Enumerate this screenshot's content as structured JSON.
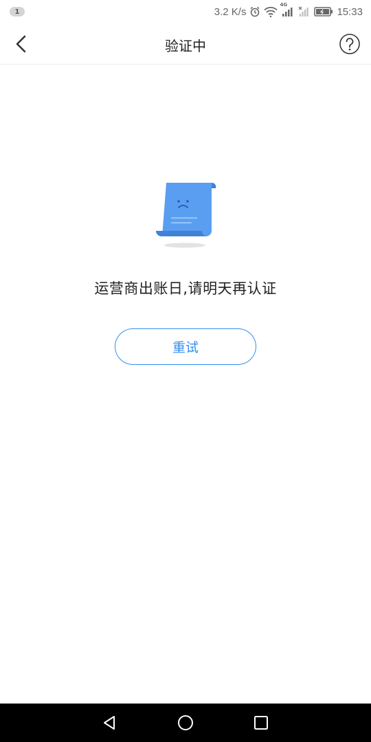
{
  "status_bar": {
    "notification_count": "1",
    "speed": "3.2 K/s",
    "time": "15:33",
    "network_label": "4G",
    "icons": [
      "alarm-icon",
      "wifi-icon",
      "signal-icon",
      "signal-icon-2",
      "battery-icon"
    ]
  },
  "header": {
    "title": "验证中",
    "back_icon": "chevron-left-icon",
    "help_icon": "question-circle-icon"
  },
  "main": {
    "illustration_icon": "sad-receipt-icon",
    "message": "运营商出账日,请明天再认证",
    "retry_label": "重试"
  },
  "nav_bar": {
    "icons": [
      "back-triangle-icon",
      "home-circle-icon",
      "recents-square-icon"
    ]
  },
  "colors": {
    "accent": "#2f8df4",
    "illustration_blue": "#4d98f0",
    "illustration_light": "#7fb6f6"
  }
}
